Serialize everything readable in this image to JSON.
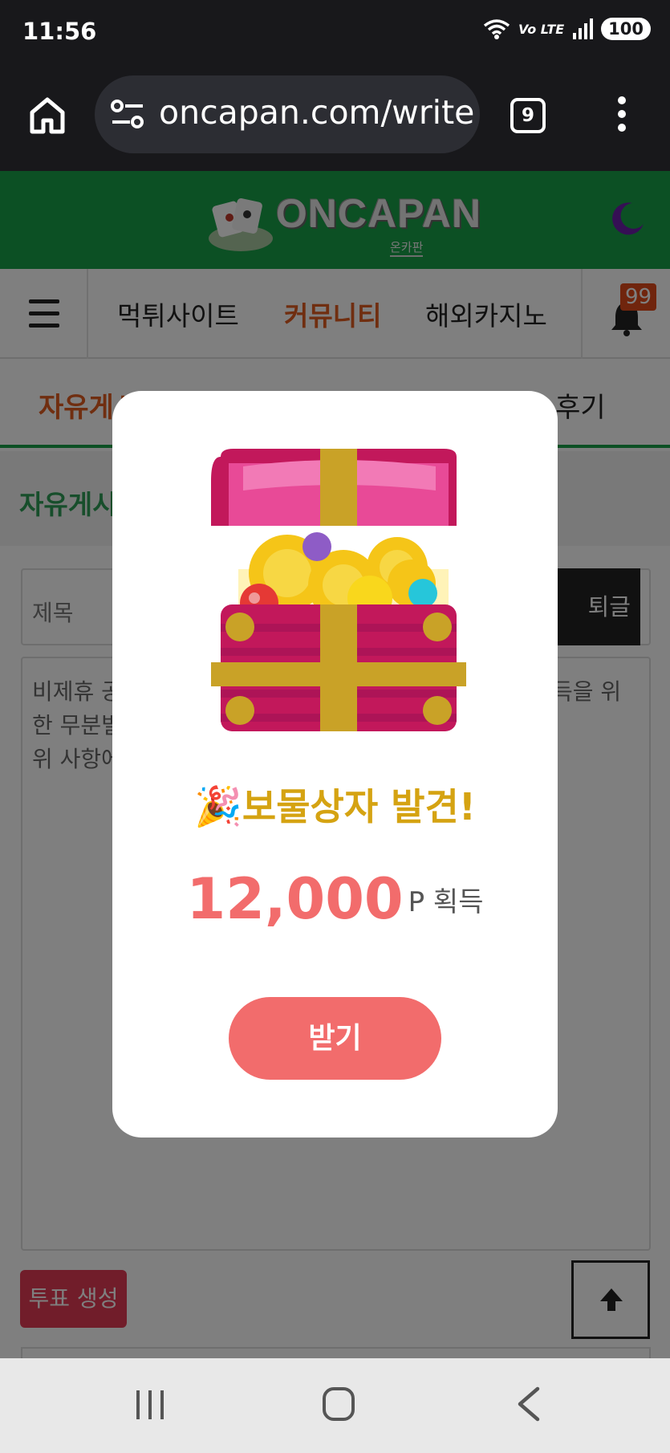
{
  "status_bar": {
    "time": "11:56",
    "network": "Vo LTE",
    "battery": "100"
  },
  "browser": {
    "url": "oncapan.com/write",
    "tab_count": "9"
  },
  "site": {
    "logo_text": "ONCAPAN",
    "logo_sub": "온카판"
  },
  "nav": {
    "items": [
      "먹튀사이트",
      "커뮤니티",
      "해외카지노"
    ],
    "active_index": 1,
    "notification_count": "99"
  },
  "subnav": {
    "active": "자유게시",
    "right": "포 후기"
  },
  "board": {
    "title": "자유게시"
  },
  "form": {
    "title_placeholder": "제목",
    "temp_button": "퇴글(11)",
    "body_lines": [
      "비제휴 공",
      "한 무분별",
      "위 사항에"
    ],
    "body_right": "득을 위",
    "vote_button": "투표 생성"
  },
  "modal": {
    "emoji": "🎉",
    "title": "보물상자 발견!",
    "amount": "12,000",
    "amount_unit": "P 획득",
    "button": "받기"
  },
  "colors": {
    "site_green": "#18a048",
    "accent_orange": "#e15c21",
    "modal_red": "#f26c6c",
    "title_gold": "#d5a312",
    "vote_red": "#e23a55"
  }
}
